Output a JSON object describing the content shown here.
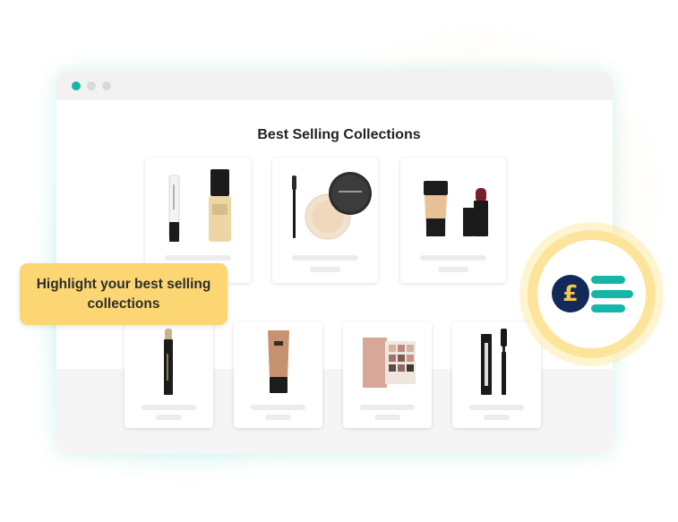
{
  "browser": {
    "window_dots": [
      "active",
      "inactive",
      "inactive"
    ]
  },
  "page": {
    "title": "Best Selling Collections"
  },
  "callout": {
    "text": "Highlight your best selling collections"
  },
  "badge": {
    "symbol": "£",
    "icon": "pound-coin-with-lines-icon"
  },
  "products": {
    "row1": [
      {
        "name": "primer-and-foundation"
      },
      {
        "name": "brush-and-loose-powder"
      },
      {
        "name": "foundation-tube-and-lipstick"
      }
    ],
    "row2": [
      {
        "name": "concealer-stick"
      },
      {
        "name": "tinted-tube"
      },
      {
        "name": "eyeshadow-palette"
      },
      {
        "name": "mascara"
      }
    ]
  },
  "colors": {
    "accent_teal": "#17b5a5",
    "callout_yellow": "#fcd673",
    "coin_navy": "#13295a",
    "coin_gold": "#f0c64c"
  }
}
